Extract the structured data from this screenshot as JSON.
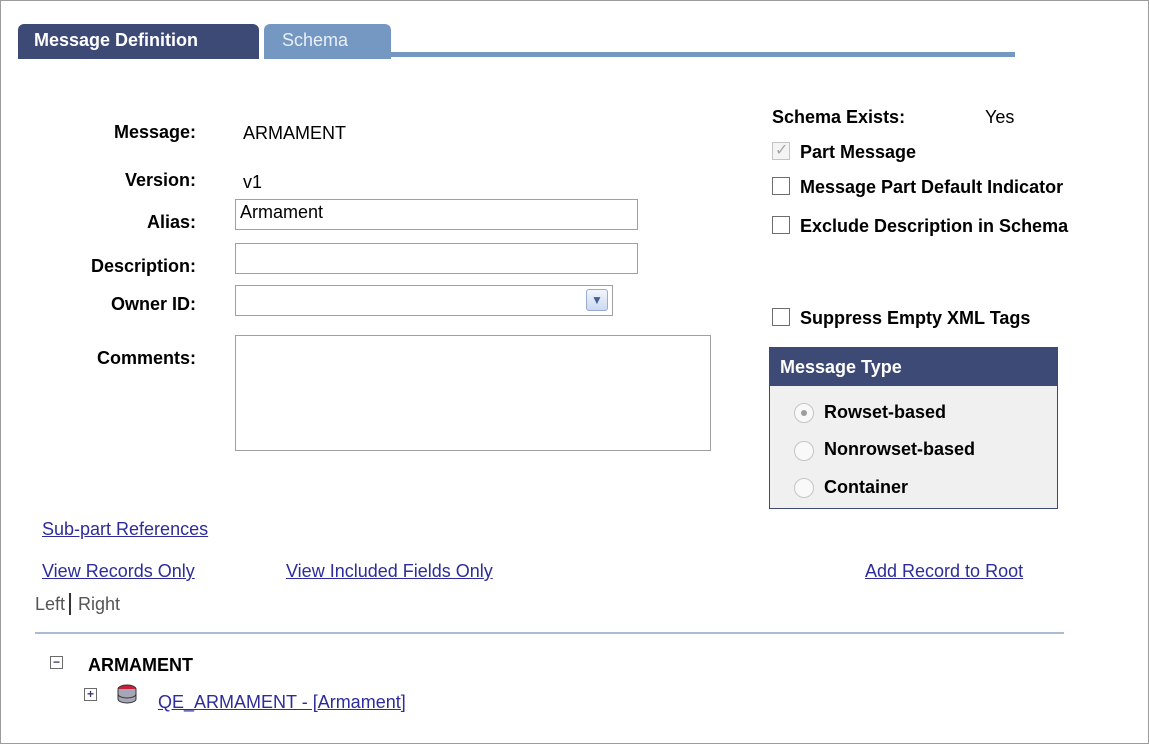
{
  "tabs": {
    "active": "Message Definition",
    "inactive": "Schema"
  },
  "form": {
    "message_label": "Message:",
    "message_value": "ARMAMENT",
    "version_label": "Version:",
    "version_value": "v1",
    "alias_label": "Alias:",
    "alias_value": "Armament",
    "description_label": "Description:",
    "description_value": "",
    "owner_label": "Owner ID:",
    "owner_value": "",
    "comments_label": "Comments:",
    "comments_value": ""
  },
  "schema_exists": {
    "label": "Schema Exists:",
    "value": "Yes"
  },
  "checkboxes": {
    "part_message": "Part Message",
    "message_part_default": "Message Part Default Indicator",
    "exclude_description": "Exclude Description in Schema",
    "suppress_empty": "Suppress Empty XML Tags"
  },
  "message_type": {
    "header": "Message Type",
    "options": [
      "Rowset-based",
      "Nonrowset-based",
      "Container"
    ],
    "selected": "Rowset-based"
  },
  "links": {
    "sub_part": "Sub-part References",
    "view_records": "View Records Only",
    "view_included": "View Included Fields Only",
    "add_record": "Add Record to Root"
  },
  "toggle": {
    "left": "Left",
    "right": "Right"
  },
  "tree": {
    "root": "ARMAMENT",
    "child": "QE_ARMAMENT - [Armament]"
  }
}
